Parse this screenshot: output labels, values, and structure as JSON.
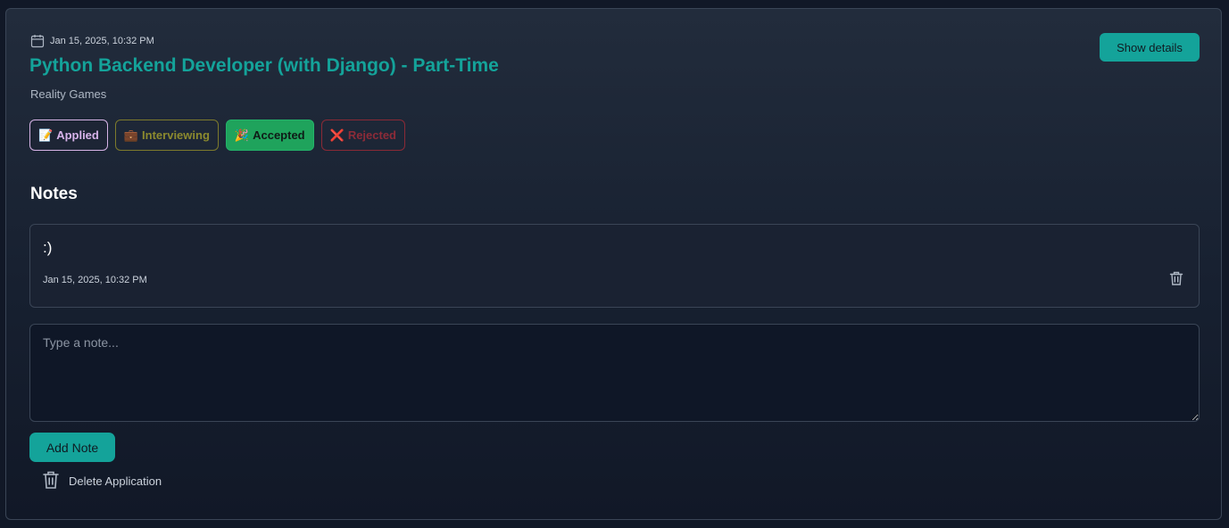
{
  "application": {
    "date": "Jan 15, 2025, 10:32 PM",
    "title": "Python Backend Developer (with Django) - Part-Time",
    "company": "Reality Games",
    "show_details_label": "Show details"
  },
  "statuses": [
    {
      "emoji": "📝",
      "label": "Applied",
      "color": "#d7b3ea"
    },
    {
      "emoji": "💼",
      "label": "Interviewing",
      "color": "#8c8a2e"
    },
    {
      "emoji": "🎉",
      "label": "Accepted",
      "color": "#1fa35c"
    },
    {
      "emoji": "❌",
      "label": "Rejected",
      "color": "#8d2b38"
    }
  ],
  "notes": {
    "heading": "Notes",
    "items": [
      {
        "text": ":)",
        "date": "Jan 15, 2025, 10:32 PM"
      }
    ],
    "input_placeholder": "Type a note...",
    "add_label": "Add Note"
  },
  "delete_application_label": "Delete Application",
  "icons": {
    "date": "calendar-icon",
    "delete": "trash-icon"
  },
  "colors": {
    "accent": "#14a39a",
    "background": "#111827"
  }
}
